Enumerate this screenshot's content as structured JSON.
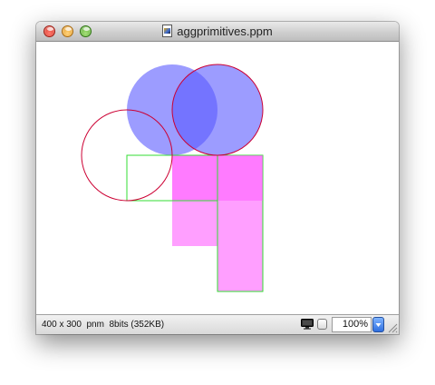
{
  "window": {
    "title": "aggprimitives.ppm"
  },
  "titlebar": {
    "buttons": [
      "close",
      "minimize",
      "zoom"
    ],
    "doc_icon": "image-document-icon"
  },
  "canvas": {
    "image_size": "400 x 300",
    "background": "#ffffff",
    "colors": {
      "circle_stroke": "#cc0033",
      "rect_stroke": "#33dd33",
      "blue_fill": "rgba(90,90,255,0.6)",
      "magenta_fill": "rgba(255,80,255,0.55)"
    }
  },
  "statusbar": {
    "info": "400 x 300  pnm  8bits (352KB)",
    "zoom_value": "100%",
    "monitor_icon": "monitor-icon",
    "stepper_icon": "chevron-down-icon"
  }
}
